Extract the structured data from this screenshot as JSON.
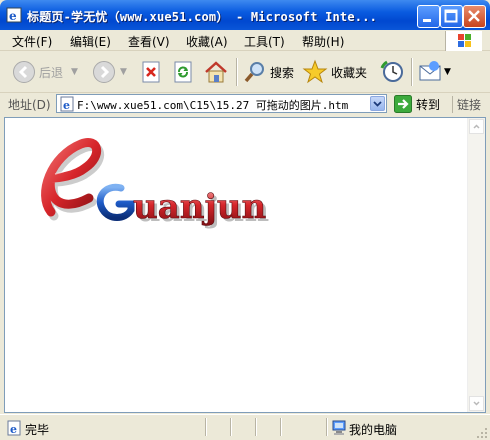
{
  "window": {
    "title": "标题页-学无忧（www.xue51.com） - Microsoft Inte..."
  },
  "menu": {
    "items": [
      {
        "label": "文件(F)"
      },
      {
        "label": "编辑(E)"
      },
      {
        "label": "查看(V)"
      },
      {
        "label": "收藏(A)"
      },
      {
        "label": "工具(T)"
      },
      {
        "label": "帮助(H)"
      }
    ]
  },
  "toolbar": {
    "back_label": "后退",
    "search_label": "搜索",
    "favorites_label": "收藏夹"
  },
  "address": {
    "label": "地址(D)",
    "value": "F:\\www.xue51.com\\C15\\15.27  可拖动的图片.htm",
    "go_label": "转到",
    "links_label": "链接"
  },
  "content": {
    "logo_text": "Guanjun",
    "logo_initial": "e"
  },
  "status": {
    "text": "完毕",
    "zone": "我的电脑"
  },
  "colors": {
    "titlebar": "#0A5BE0",
    "logo_red": "#D7262B",
    "logo_blue": "#1E5BC8"
  }
}
